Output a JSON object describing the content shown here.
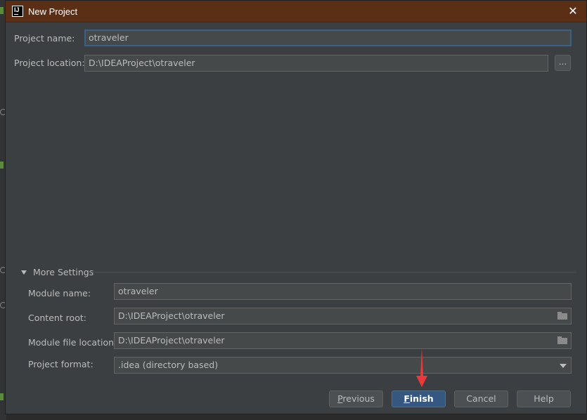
{
  "dialog": {
    "title": "New Project",
    "project_name_label": "Project name:",
    "project_name_value": "otraveler",
    "project_location_label": "Project location:",
    "project_location_value": "D:\\IDEAProject\\otraveler",
    "browse_label": "...",
    "more_settings_label": "More Settings",
    "module_name_label": "Module name:",
    "module_name_value": "otraveler",
    "content_root_label": "Content root:",
    "content_root_value": "D:\\IDEAProject\\otraveler",
    "module_file_location_label": "Module file location:",
    "module_file_location_value": "D:\\IDEAProject\\otraveler",
    "project_format_label": "Project format:",
    "project_format_value": ".idea (directory based)"
  },
  "buttons": {
    "previous_first": "P",
    "previous_rest": "revious",
    "finish_first": "F",
    "finish_rest": "inish",
    "cancel": "Cancel",
    "help": "Help"
  },
  "icons": {
    "app": "intellij-idea-icon",
    "close": "close-icon",
    "folder": "folder-icon",
    "collapse": "triangle-down-icon",
    "dropdown": "chevron-down-icon",
    "annotation": "red-arrow-icon"
  },
  "colors": {
    "titlebar": "#5b2e16",
    "dialog_bg": "#3c3f41",
    "primary_button": "#365880",
    "focus_border": "#3d6185",
    "annotation_arrow": "#e8393c"
  }
}
